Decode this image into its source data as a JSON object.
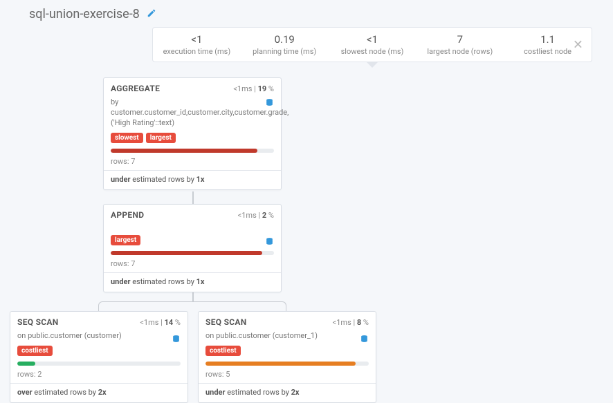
{
  "title": "sql-union-exercise-8",
  "stats": [
    {
      "value": "<1",
      "label": "execution time (ms)"
    },
    {
      "value": "0.19",
      "label": "planning time (ms)"
    },
    {
      "value": "<1",
      "label": "slowest node (ms)"
    },
    {
      "value": "7",
      "label": "largest node (rows)"
    },
    {
      "value": "1.1",
      "label": "costliest node"
    }
  ],
  "nodes": {
    "aggregate": {
      "title": "AGGREGATE",
      "time": "<1",
      "pct": "19",
      "desc": "by customer.customer_id,customer.city,customer.grade,('High Rating'::text)",
      "tags": [
        "slowest",
        "largest"
      ],
      "barColor": "bar-red",
      "barPct": 90,
      "rows": "rows: 7",
      "estPrefix": "under",
      "estMid": " estimated rows by ",
      "estMult": "1x"
    },
    "append": {
      "title": "APPEND",
      "time": "<1",
      "pct": "2",
      "desc": "",
      "tags": [
        "largest"
      ],
      "barColor": "bar-red",
      "barPct": 93,
      "rows": "rows: 7",
      "estPrefix": "under",
      "estMid": " estimated rows by ",
      "estMult": "1x"
    },
    "seq1": {
      "title": "SEQ SCAN",
      "time": "<1",
      "pct": "14",
      "desc": "on public.customer (customer)",
      "tags": [
        "costliest"
      ],
      "barColor": "bar-green",
      "barPct": 11,
      "rows": "rows: 2",
      "estPrefix": "over",
      "estMid": " estimated rows by ",
      "estMult": "2x"
    },
    "seq2": {
      "title": "SEQ SCAN",
      "time": "<1",
      "pct": "8",
      "desc": "on public.customer (customer_1)",
      "tags": [
        "costliest"
      ],
      "barColor": "bar-orange",
      "barPct": 92,
      "rows": "rows: 5",
      "estPrefix": "under",
      "estMid": " estimated rows by ",
      "estMult": "2x"
    }
  }
}
